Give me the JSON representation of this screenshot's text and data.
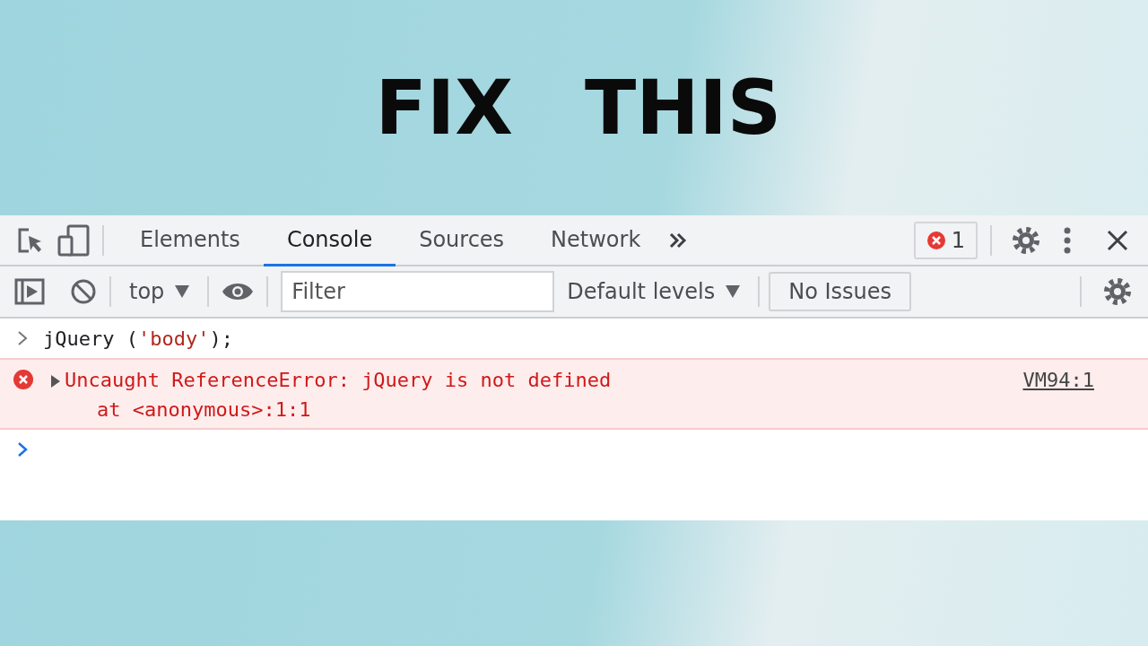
{
  "headline": [
    "FIX",
    "THIS"
  ],
  "tabs": [
    {
      "label": "Elements",
      "selected": false
    },
    {
      "label": "Console",
      "selected": true
    },
    {
      "label": "Sources",
      "selected": false
    },
    {
      "label": "Network",
      "selected": false
    }
  ],
  "error_count": "1",
  "toolbar": {
    "context": "top",
    "filter": {
      "placeholder": "Filter"
    },
    "levels": "Default levels",
    "issues": "No Issues"
  },
  "console": [
    {
      "kind": "input",
      "code": [
        {
          "kind": "plain",
          "text": "jQuery ("
        },
        {
          "kind": "string",
          "text": "'body'"
        },
        {
          "kind": "plain",
          "text": ");"
        }
      ]
    },
    {
      "kind": "error",
      "expanded": false,
      "message": "Uncaught ReferenceError: jQuery is not defined",
      "stack": "at <anonymous>:1:1",
      "source": "VM94:1"
    },
    {
      "kind": "prompt"
    }
  ]
}
